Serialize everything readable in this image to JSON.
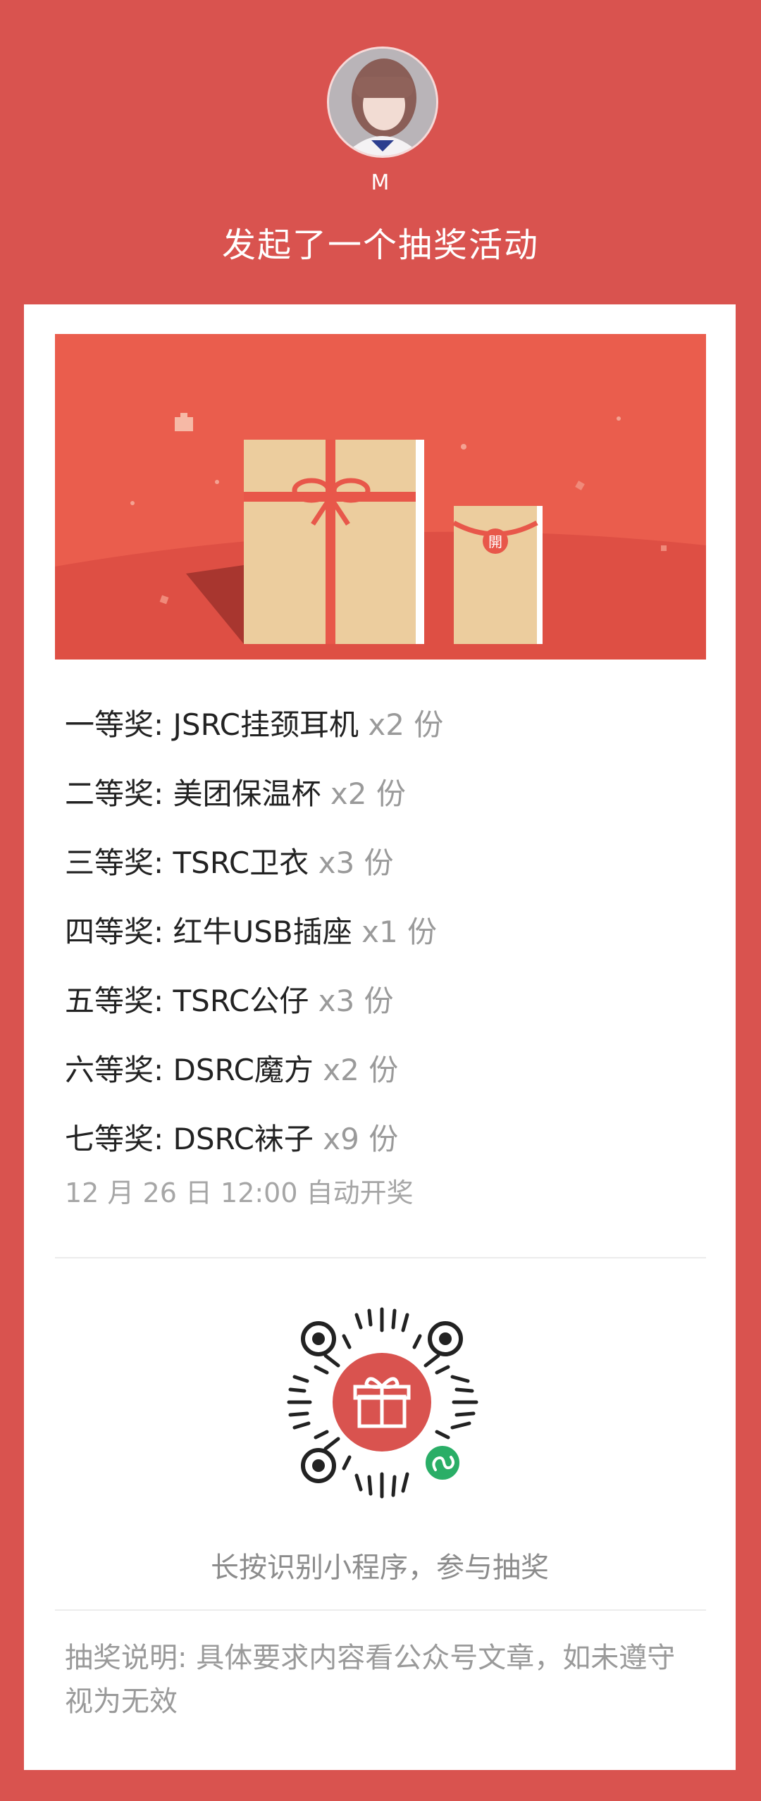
{
  "header": {
    "avatar_alt": "avatar",
    "username": "M",
    "headline": "发起了一个抽奖活动"
  },
  "banner": {
    "seal_char": "開"
  },
  "prizes": [
    {
      "tier": "一等奖:",
      "name": "JSRC挂颈耳机",
      "qty": "x2 份"
    },
    {
      "tier": "二等奖:",
      "name": "美团保温杯",
      "qty": "x2 份"
    },
    {
      "tier": "三等奖:",
      "name": "TSRC卫衣",
      "qty": "x3 份"
    },
    {
      "tier": "四等奖:",
      "name": "红牛USB插座",
      "qty": "x1 份"
    },
    {
      "tier": "五等奖:",
      "name": "TSRC公仔",
      "qty": "x3 份"
    },
    {
      "tier": "六等奖:",
      "name": "DSRC魔方",
      "qty": "x2 份"
    },
    {
      "tier": "七等奖:",
      "name": "DSRC袜子",
      "qty": "x9 份"
    }
  ],
  "draw_time": "12 月 26 日 12:00 自动开奖",
  "qr": {
    "caption": "长按识别小程序，参与抽奖",
    "center_icon": "gift-icon",
    "badge_icon": "mini-program-icon"
  },
  "rules": "抽奖说明: 具体要求内容看公众号文章，如未遵守视为无效",
  "colors": {
    "background": "#d9534f",
    "banner": "#e8624f",
    "box": "#e9c99a",
    "ribbon": "#e8574a",
    "mini_program_badge": "#2aae67"
  }
}
